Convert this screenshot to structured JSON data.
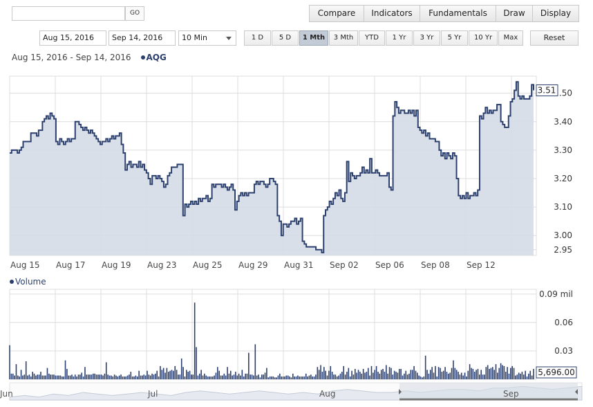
{
  "toolbar": {
    "go_label": "GO",
    "buttons": [
      "Compare",
      "Indicators",
      "Fundamentals",
      "Draw",
      "Display"
    ]
  },
  "dates": {
    "start": "Aug 15, 2016",
    "end": "Sep 14, 2016"
  },
  "interval": "10 Min",
  "ranges": [
    "1 D",
    "5 D",
    "1 Mth",
    "3 Mth",
    "YTD",
    "1 Yr",
    "3 Yr",
    "5 Yr",
    "10 Yr",
    "Max"
  ],
  "active_range": "1 Mth",
  "reset_label": "Reset",
  "range_label": "Aug 15, 2016 - Sep 14, 2016",
  "symbol": "AQG",
  "volume_label": "Volume",
  "colors": {
    "line": "#2b3f6e",
    "fill": "#d5dce6",
    "grid": "#dcdcdc",
    "active_range": "#c3ccd6"
  },
  "chart_data": [
    {
      "type": "area",
      "series": [
        {
          "name": "AQG",
          "values": [
            3.29,
            3.3,
            3.3,
            3.3,
            3.29,
            3.3,
            3.31,
            3.33,
            3.33,
            3.33,
            3.33,
            3.36,
            3.36,
            3.36,
            3.35,
            3.37,
            3.37,
            3.4,
            3.41,
            3.42,
            3.41,
            3.43,
            3.42,
            3.41,
            3.33,
            3.32,
            3.34,
            3.33,
            3.32,
            3.33,
            3.34,
            3.33,
            3.34,
            3.34,
            3.4,
            3.4,
            3.39,
            3.38,
            3.37,
            3.38,
            3.37,
            3.36,
            3.37,
            3.36,
            3.35,
            3.34,
            3.33,
            3.32,
            3.33,
            3.33,
            3.34,
            3.33,
            3.34,
            3.35,
            3.34,
            3.35,
            3.35,
            3.36,
            3.32,
            3.29,
            3.23,
            3.25,
            3.26,
            3.24,
            3.25,
            3.25,
            3.24,
            3.26,
            3.24,
            3.25,
            3.23,
            3.22,
            3.2,
            3.18,
            3.21,
            3.21,
            3.2,
            3.21,
            3.2,
            3.19,
            3.17,
            3.18,
            3.21,
            3.22,
            3.24,
            3.24,
            3.24,
            3.25,
            3.25,
            3.25,
            3.07,
            3.11,
            3.1,
            3.11,
            3.12,
            3.11,
            3.12,
            3.11,
            3.13,
            3.12,
            3.13,
            3.13,
            3.14,
            3.12,
            3.13,
            3.18,
            3.17,
            3.18,
            3.18,
            3.18,
            3.17,
            3.18,
            3.17,
            3.16,
            3.17,
            3.18,
            3.16,
            3.09,
            3.12,
            3.14,
            3.15,
            3.14,
            3.15,
            3.14,
            3.15,
            3.15,
            3.15,
            3.18,
            3.19,
            3.18,
            3.19,
            3.19,
            3.18,
            3.17,
            3.18,
            3.2,
            3.2,
            3.19,
            3.18,
            3.07,
            3.05,
            3.0,
            3.04,
            3.04,
            3.03,
            3.04,
            3.05,
            3.05,
            3.06,
            3.04,
            3.05,
            3.06,
            2.98,
            2.97,
            2.96,
            2.96,
            2.96,
            2.96,
            2.96,
            2.95,
            2.95,
            2.95,
            2.94,
            3.07,
            3.09,
            3.1,
            3.12,
            3.11,
            3.13,
            3.15,
            3.14,
            3.16,
            3.13,
            3.12,
            3.15,
            3.26,
            3.19,
            3.22,
            3.21,
            3.2,
            3.21,
            3.21,
            3.22,
            3.24,
            3.22,
            3.23,
            3.22,
            3.27,
            3.22,
            3.22,
            3.23,
            3.22,
            3.21,
            3.21,
            3.21,
            3.21,
            3.22,
            3.17,
            3.16,
            3.42,
            3.47,
            3.45,
            3.43,
            3.44,
            3.44,
            3.43,
            3.43,
            3.44,
            3.43,
            3.44,
            3.42,
            3.44,
            3.38,
            3.37,
            3.36,
            3.37,
            3.35,
            3.36,
            3.34,
            3.34,
            3.34,
            3.33,
            3.33,
            3.3,
            3.28,
            3.29,
            3.27,
            3.29,
            3.28,
            3.27,
            3.29,
            3.28,
            3.2,
            3.14,
            3.13,
            3.14,
            3.13,
            3.15,
            3.13,
            3.14,
            3.14,
            3.15,
            3.14,
            3.16,
            3.42,
            3.41,
            3.43,
            3.45,
            3.43,
            3.44,
            3.43,
            3.44,
            3.44,
            3.46,
            3.46,
            3.4,
            3.39,
            3.38,
            3.38,
            3.42,
            3.47,
            3.48,
            3.51,
            3.54,
            3.49,
            3.48,
            3.49,
            3.48,
            3.48,
            3.48,
            3.49,
            3.53,
            3.51
          ]
        }
      ],
      "x_labels": [
        "Aug 15",
        "Aug 17",
        "Aug 19",
        "Aug 23",
        "Aug 25",
        "Aug 29",
        "Aug 31",
        "Sep 02",
        "Sep 06",
        "Sep 08",
        "Sep 12"
      ],
      "y_ticks": [
        3.5,
        3.4,
        3.3,
        3.2,
        3.1,
        3.0,
        2.95
      ],
      "y_tick_labels": [
        ".50",
        "3.40",
        "3.30",
        "3.20",
        "3.10",
        "3.00",
        "2.95"
      ],
      "ylim": [
        2.93,
        3.56
      ],
      "last_value_label": "3.51",
      "grid": true
    },
    {
      "type": "bar",
      "series": [
        {
          "name": "Volume",
          "values": [
            36,
            6,
            6,
            4,
            16,
            4,
            3,
            10,
            4,
            5,
            19,
            4,
            5,
            3,
            8,
            6,
            4,
            5,
            5,
            8,
            4,
            4,
            4,
            12,
            6,
            5,
            5,
            5,
            4,
            4,
            4,
            4,
            3,
            3,
            20,
            11,
            4,
            4,
            5,
            3,
            5,
            3,
            5,
            5,
            7,
            3,
            13,
            5,
            5,
            5,
            5,
            6,
            6,
            5,
            5,
            5,
            5,
            4,
            6,
            18,
            5,
            4,
            4,
            3,
            5,
            4,
            3,
            4,
            5,
            3,
            3,
            3,
            4,
            5,
            8,
            3,
            3,
            4,
            3,
            9,
            4,
            4,
            5,
            4,
            9,
            5,
            4,
            6,
            5,
            6,
            9,
            3,
            14,
            10,
            12,
            7,
            12,
            8,
            9,
            10,
            9,
            14,
            10,
            5,
            5,
            22,
            13,
            3,
            10,
            8,
            9,
            5,
            5,
            81,
            34,
            4,
            6,
            10,
            4,
            6,
            4,
            3,
            3,
            3,
            3,
            4,
            7,
            13,
            9,
            4,
            4,
            6,
            4,
            13,
            6,
            9,
            4,
            5,
            8,
            4,
            6,
            4,
            10,
            3,
            6,
            6,
            28,
            5,
            5,
            4,
            37,
            4,
            5,
            2,
            5,
            5,
            7,
            12,
            2,
            3,
            3,
            3,
            2,
            2,
            4,
            6,
            3,
            3,
            3,
            4,
            4,
            3,
            2,
            6,
            3,
            3,
            4,
            3,
            3,
            3,
            3,
            6,
            3,
            4,
            5,
            3,
            3,
            5,
            13,
            10,
            15,
            8,
            13,
            9,
            4,
            9,
            14,
            8,
            5,
            5,
            3,
            4,
            6,
            8,
            14,
            5,
            8,
            12,
            3,
            9,
            5,
            11,
            7,
            10,
            8,
            6,
            11,
            7,
            8,
            12,
            4,
            14,
            7,
            10,
            14,
            8,
            6,
            10,
            11,
            8,
            15,
            6,
            13,
            12,
            5,
            9,
            8,
            7,
            11,
            11,
            4,
            6,
            9,
            5,
            6,
            10,
            10,
            14,
            9,
            7,
            4,
            3,
            2,
            3,
            25,
            10,
            6,
            10,
            13,
            7,
            14,
            3,
            13,
            12,
            8,
            9,
            13,
            8,
            6,
            7,
            12,
            20,
            12,
            10,
            8,
            5,
            7,
            4,
            7,
            3,
            9,
            16,
            12,
            11,
            8,
            10,
            11,
            5,
            10,
            5,
            5,
            13,
            15,
            11,
            12,
            13,
            10,
            16,
            7,
            12,
            17,
            15,
            14,
            8,
            13,
            6,
            12,
            14,
            12,
            4,
            5,
            7,
            6,
            8,
            5,
            9,
            3,
            6,
            9,
            4,
            11
          ]
        }
      ],
      "y_ticks": [
        0.03,
        0.06,
        0.09
      ],
      "y_tick_labels": [
        "0.03",
        "0.06",
        "0.09 mil"
      ],
      "ylim": [
        0,
        0.095
      ],
      "last_value_label": "5,696.00",
      "grid": true
    },
    {
      "type": "area",
      "series": [
        {
          "name": "navigator",
          "values": [
            3.0,
            3.1,
            3.0,
            3.2,
            3.1,
            3.3,
            3.2,
            3.1,
            3.2,
            3.3,
            3.2,
            3.1,
            3.3,
            3.4,
            3.3,
            3.2,
            3.3,
            3.4,
            3.3,
            3.2,
            3.3,
            3.2,
            3.4,
            3.5,
            3.4,
            3.3,
            3.3,
            3.4,
            3.3,
            3.4,
            3.5,
            3.5,
            3.4,
            3.6,
            3.6,
            3.7,
            3.6,
            3.5,
            3.6,
            3.7
          ]
        }
      ],
      "x_labels": [
        "Jun",
        "Jul",
        "Aug",
        "Sep"
      ]
    }
  ]
}
